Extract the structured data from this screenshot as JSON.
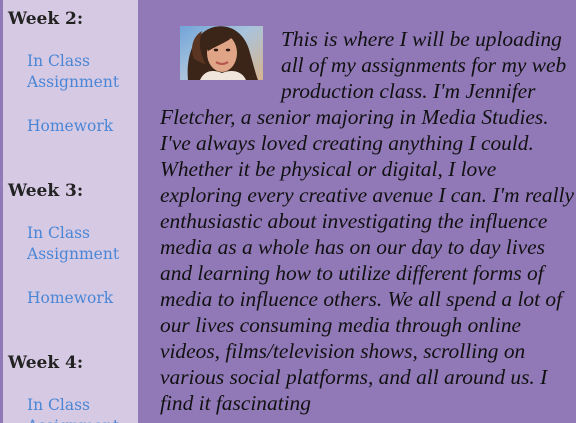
{
  "sidebar": {
    "weeks": [
      {
        "heading": "Week 2:",
        "class_link": "In Class Assignment",
        "homework_link": "Homework"
      },
      {
        "heading": "Week 3:",
        "class_link": "In Class Assignment",
        "homework_link": "Homework"
      },
      {
        "heading": "Week 4:",
        "class_link": "In Class Assignment"
      }
    ]
  },
  "main": {
    "intro": "This is where I will be uploading all of my assignments for my web production class. I'm Jennifer Fletcher, a senior majoring in Media Studies. I've always loved creating anything I could. Whether it be physical or digital, I love exploring every creative avenue I can. I'm really enthusiastic about investigating the influence media as a whole has on our day to day lives and learning how to utilize different forms of media to influence others. We all spend a lot of our lives consuming media through online videos, films/television shows, scrolling on various social platforms, and all around us. I find it fascinating"
  }
}
